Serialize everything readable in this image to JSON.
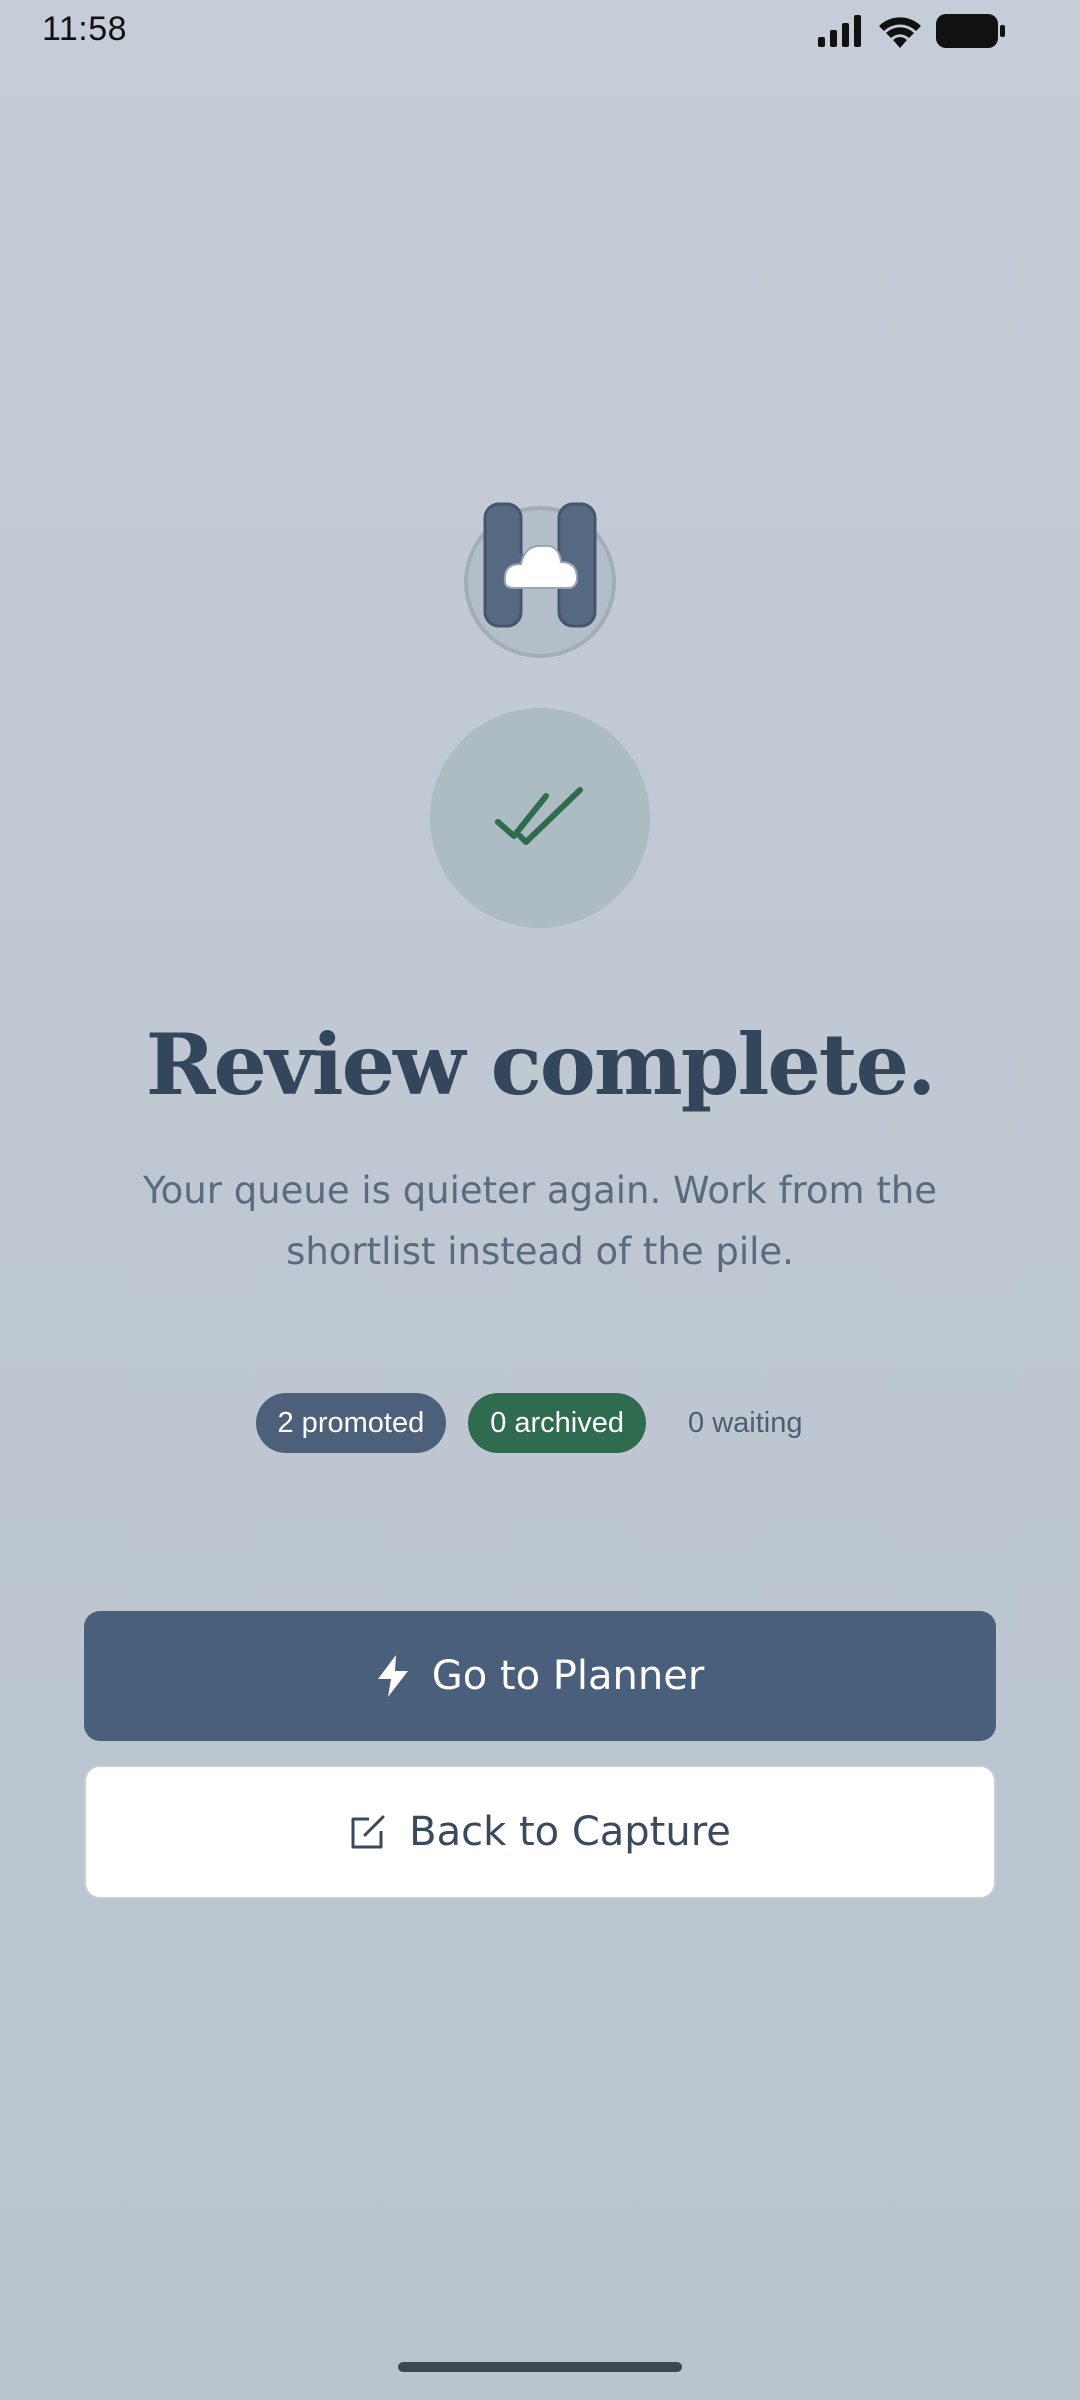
{
  "status_bar": {
    "time": "11:58",
    "icons": [
      "signal-icon",
      "wifi-icon",
      "battery-icon"
    ]
  },
  "logo": {
    "icon": "cloud-logo-icon"
  },
  "status_icon": {
    "icon": "double-check-icon",
    "color": "#2f6b4e"
  },
  "heading": {
    "title": "Review complete.",
    "subtitle": "Your queue is quieter again. Work from the shortlist instead of the pile."
  },
  "stats": {
    "promoted": "2 promoted",
    "archived": "0 archived",
    "waiting": "0 waiting"
  },
  "actions": {
    "primary_label": "Go to Planner",
    "primary_icon": "bolt-icon",
    "secondary_label": "Back to Capture",
    "secondary_icon": "edit-icon"
  },
  "colors": {
    "accent": "#4a5f7b",
    "success": "#2f6b4e",
    "background": "#c2cad5"
  }
}
